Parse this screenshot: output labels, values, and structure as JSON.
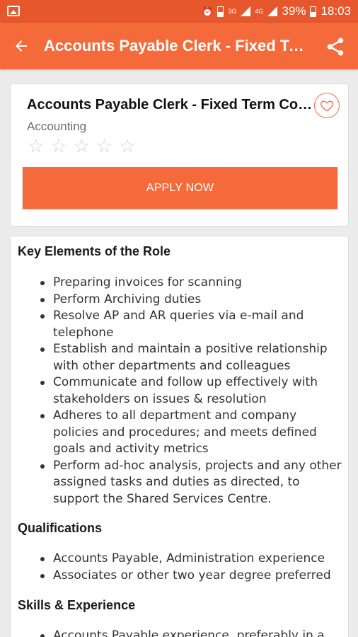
{
  "status_bar": {
    "battery_percent": "39%",
    "time": "18:03",
    "network_1": "3G",
    "network_2": "4G"
  },
  "app_bar": {
    "title": "Accounts Payable Clerk - Fixed Term Contract",
    "back_icon": "arrow-back-icon",
    "share_icon": "share-icon"
  },
  "job": {
    "title": "Accounts Payable Clerk - Fixed Term Contract",
    "category": "Accounting",
    "rating": 0,
    "rating_max": 5,
    "apply_label": "APPLY NOW",
    "favorite_icon": "heart-outline-icon"
  },
  "description": {
    "sections": [
      {
        "heading": "Key Elements of the Role",
        "items": [
          "Preparing invoices for scanning",
          "Perform Archiving duties",
          "Resolve AP and AR queries via e-mail and telephone",
          "Establish and maintain a positive relationship with other departments  and colleagues",
          "Communicate and follow up effectively with stakeholders on issues & resolution",
          "Adheres to all department and company policies and procedures; and meets defined goals and activity metrics",
          "Perform ad-hoc analysis, projects and any other assigned tasks and duties as directed, to support the Shared Services Centre."
        ]
      },
      {
        "heading": "Qualifications",
        "items": [
          "Accounts Payable, Administration experience",
          "Associates or other two year degree preferred"
        ]
      },
      {
        "heading": "Skills & Experience",
        "items": [
          "Accounts Payable experience, preferably in a"
        ]
      }
    ]
  },
  "colors": {
    "status_bar": "#e6582c",
    "primary": "#f46a3b",
    "background": "#ececec"
  }
}
